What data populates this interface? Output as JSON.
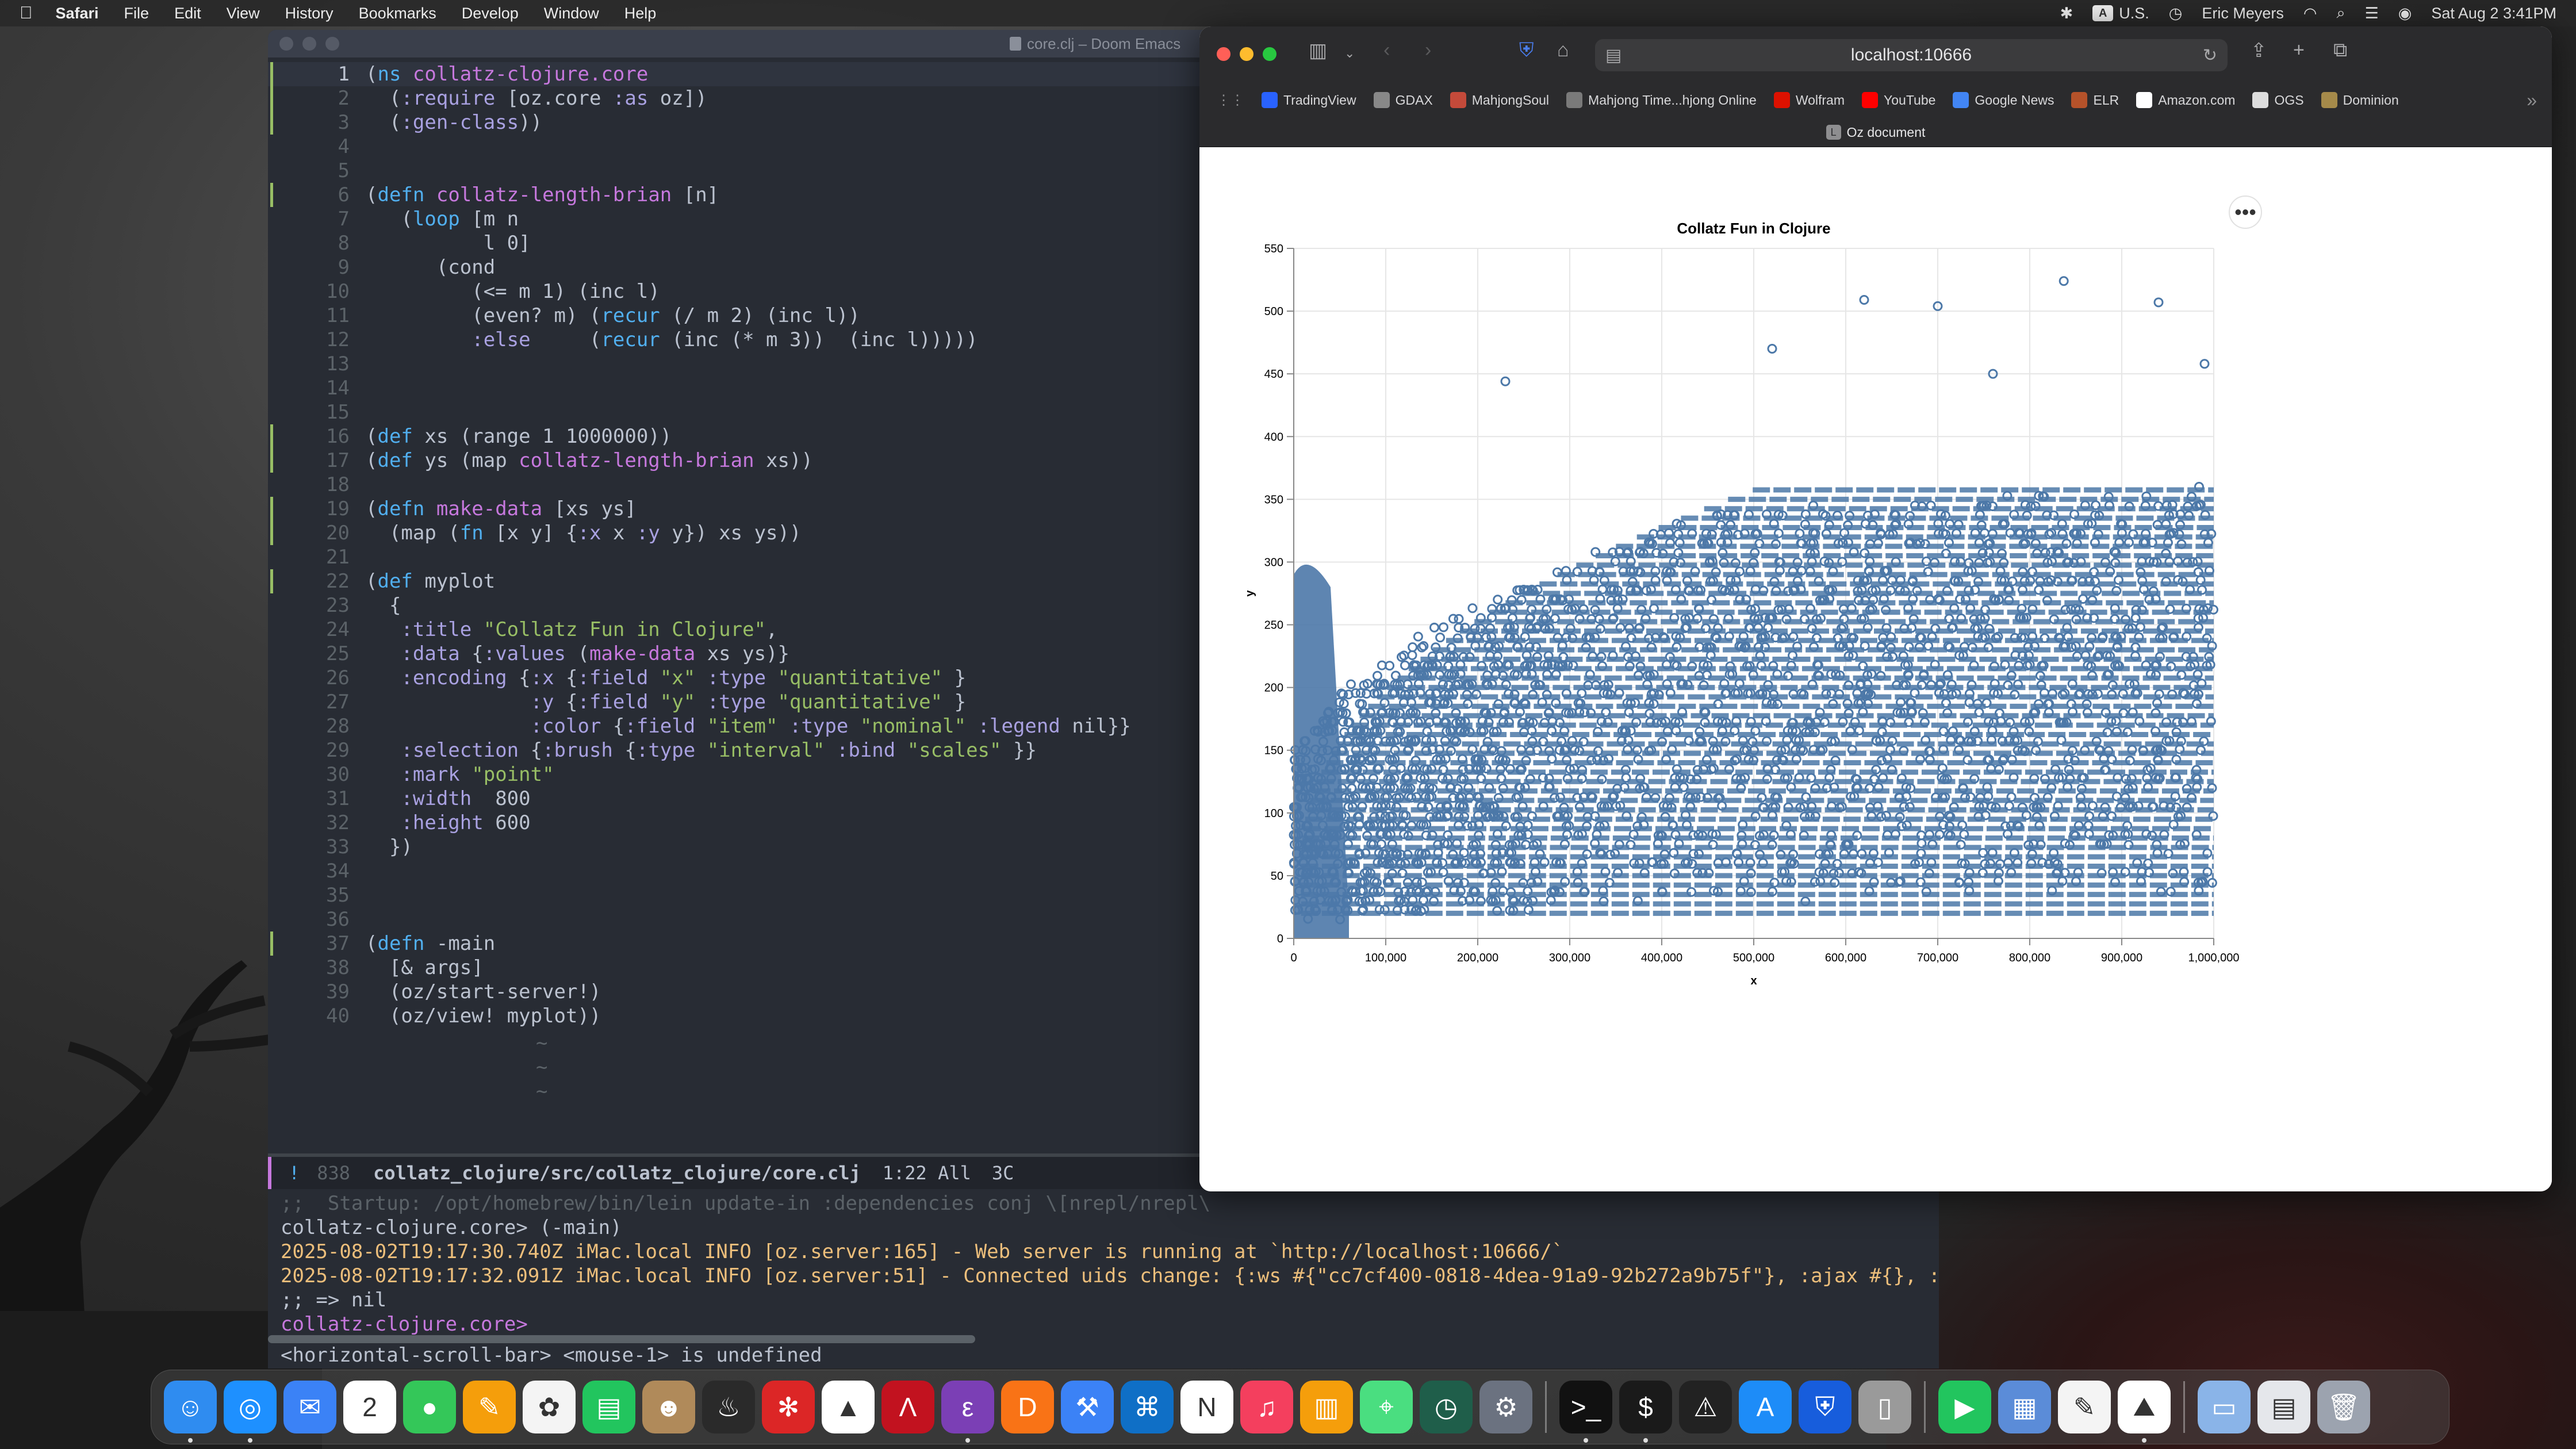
{
  "menubar": {
    "app": "Safari",
    "items": [
      "File",
      "Edit",
      "View",
      "History",
      "Bookmarks",
      "Develop",
      "Window",
      "Help"
    ],
    "input_source": "A",
    "locale": "U.S.",
    "user": "Eric Meyers",
    "datetime": "Sat Aug 2  3:41PM"
  },
  "emacs": {
    "title": "core.clj – Doom Emacs",
    "lines": [
      {
        "n": "1",
        "t": "(ns collatz-clojure.core",
        "mark": true,
        "cur": true
      },
      {
        "n": "2",
        "t": "  (:require [oz.core :as oz])",
        "mark": true
      },
      {
        "n": "3",
        "t": "  (:gen-class))",
        "mark": true
      },
      {
        "n": "4",
        "t": ""
      },
      {
        "n": "5",
        "t": ""
      },
      {
        "n": "6",
        "t": "(defn collatz-length-brian [n]",
        "mark": true
      },
      {
        "n": "7",
        "t": "   (loop [m n"
      },
      {
        "n": "8",
        "t": "          l 0]"
      },
      {
        "n": "9",
        "t": "      (cond"
      },
      {
        "n": "10",
        "t": "         (<= m 1) (inc l)"
      },
      {
        "n": "11",
        "t": "         (even? m) (recur (/ m 2) (inc l))"
      },
      {
        "n": "12",
        "t": "         :else     (recur (inc (* m 3))  (inc l)))))"
      },
      {
        "n": "13",
        "t": ""
      },
      {
        "n": "14",
        "t": ""
      },
      {
        "n": "15",
        "t": ""
      },
      {
        "n": "16",
        "t": "(def xs (range 1 1000000))",
        "mark": true
      },
      {
        "n": "17",
        "t": "(def ys (map collatz-length-brian xs))",
        "mark": true
      },
      {
        "n": "18",
        "t": ""
      },
      {
        "n": "19",
        "t": "(defn make-data [xs ys]",
        "mark": true
      },
      {
        "n": "20",
        "t": "  (map (fn [x y] {:x x :y y}) xs ys))",
        "mark": true
      },
      {
        "n": "21",
        "t": ""
      },
      {
        "n": "22",
        "t": "(def myplot",
        "mark": true
      },
      {
        "n": "23",
        "t": "  {"
      },
      {
        "n": "24",
        "t": "   :title \"Collatz Fun in Clojure\","
      },
      {
        "n": "25",
        "t": "   :data {:values (make-data xs ys)}"
      },
      {
        "n": "26",
        "t": "   :encoding {:x {:field \"x\" :type \"quantitative\" }"
      },
      {
        "n": "27",
        "t": "              :y {:field \"y\" :type \"quantitative\" }"
      },
      {
        "n": "28",
        "t": "              :color {:field \"item\" :type \"nominal\" :legend nil}}"
      },
      {
        "n": "29",
        "t": "   :selection {:brush {:type \"interval\" :bind \"scales\" }}"
      },
      {
        "n": "30",
        "t": "   :mark \"point\""
      },
      {
        "n": "31",
        "t": "   :width  800"
      },
      {
        "n": "32",
        "t": "   :height 600"
      },
      {
        "n": "33",
        "t": "  })"
      },
      {
        "n": "34",
        "t": ""
      },
      {
        "n": "35",
        "t": ""
      },
      {
        "n": "36",
        "t": ""
      },
      {
        "n": "37",
        "t": "(defn -main",
        "mark": true
      },
      {
        "n": "38",
        "t": "  [& args]"
      },
      {
        "n": "39",
        "t": "  (oz/start-server!)"
      },
      {
        "n": "40",
        "t": "  (oz/view! myplot))"
      }
    ],
    "modeline": {
      "info_icon": "!",
      "count": "838",
      "path": "collatz_clojure/src/collatz_clojure/core.clj",
      "position": "1:22 All",
      "column": "3C"
    },
    "repl": [
      {
        "t": ";;  Startup: /opt/homebrew/bin/lein update-in :dependencies conj \\[nrepl/nrepl\\",
        "c": "#5b6268"
      },
      {
        "t": "collatz-clojure.core> (-main)",
        "c": "#bbc2cf"
      },
      {
        "t": "2025-08-02T19:17:30.740Z iMac.local INFO [oz.server:165] - Web server is running at `http://localhost:10666/`",
        "c": "#ecbe7b"
      },
      {
        "t": "2025-08-02T19:17:32.091Z iMac.local INFO [oz.server:51] - Connected uids change: {:ws #{\"cc7cf400-0818-4dea-91a9-92b272a9b75f\"}, :ajax #{}, :a$",
        "c": "#ecbe7b"
      },
      {
        "t": ";; => nil",
        "c": "#bbc2cf"
      },
      {
        "t": "collatz-clojure.core>",
        "c": "#c678dd"
      }
    ],
    "minibuffer": "<horizontal-scroll-bar> <mouse-1> is undefined"
  },
  "safari": {
    "url": "localhost:10666",
    "favorites": [
      {
        "label": "TradingView",
        "color": "#2962ff"
      },
      {
        "label": "GDAX",
        "color": "#888888"
      },
      {
        "label": "MahjongSoul",
        "color": "#c44a3a"
      },
      {
        "label": "Mahjong Time...hjong Online",
        "color": "#7a7a7a"
      },
      {
        "label": "Wolfram",
        "color": "#dd1100"
      },
      {
        "label": "YouTube",
        "color": "#ff0000"
      },
      {
        "label": "Google News",
        "color": "#4285f4"
      },
      {
        "label": "ELR",
        "color": "#b5522a"
      },
      {
        "label": "Amazon.com",
        "color": "#ffffff"
      },
      {
        "label": "OGS",
        "color": "#dddddd"
      },
      {
        "label": "Dominion",
        "color": "#a58a4a"
      }
    ],
    "tab_title": "Oz document",
    "tab_icon": "L",
    "chart_menu": "•••"
  },
  "chart_data": {
    "type": "scatter",
    "title": "Collatz Fun in Clojure",
    "xlabel": "x",
    "ylabel": "y",
    "xlim": [
      0,
      1000000
    ],
    "ylim": [
      0,
      550
    ],
    "x_ticks": [
      "0",
      "100,000",
      "200,000",
      "300,000",
      "400,000",
      "500,000",
      "600,000",
      "700,000",
      "800,000",
      "900,000",
      "1,000,000"
    ],
    "y_ticks": [
      "0",
      "50",
      "100",
      "150",
      "200",
      "250",
      "300",
      "350",
      "400",
      "450",
      "500",
      "550"
    ],
    "grid": true,
    "mark": "point",
    "color": "#4c78a8",
    "outliers": [
      {
        "x": 230000,
        "y": 444
      },
      {
        "x": 520000,
        "y": 470
      },
      {
        "x": 620000,
        "y": 509
      },
      {
        "x": 700000,
        "y": 504
      },
      {
        "x": 837000,
        "y": 524
      },
      {
        "x": 940000,
        "y": 507
      },
      {
        "x": 760000,
        "y": 450
      },
      {
        "x": 990000,
        "y": 458
      }
    ]
  },
  "dock": {
    "icons": [
      {
        "name": "finder-icon",
        "color": "#2f8cf0",
        "glyph": "☺",
        "dot": true
      },
      {
        "name": "safari-icon",
        "color": "#1e90ff",
        "glyph": "◎",
        "dot": true
      },
      {
        "name": "mail-icon",
        "color": "#3b82f6",
        "glyph": "✉"
      },
      {
        "name": "calendar-icon",
        "color": "#ffffff",
        "glyph": "2"
      },
      {
        "name": "messages-icon",
        "color": "#34c759",
        "glyph": "●"
      },
      {
        "name": "pages-icon",
        "color": "#f59e0b",
        "glyph": "✎"
      },
      {
        "name": "photos-icon",
        "color": "#f4f4f4",
        "glyph": "✿"
      },
      {
        "name": "numbers-icon",
        "color": "#22c55e",
        "glyph": "▤"
      },
      {
        "name": "contacts-icon",
        "color": "#b08a5a",
        "glyph": "☻"
      },
      {
        "name": "instruments-icon",
        "color": "#2a2a2a",
        "glyph": "♨"
      },
      {
        "name": "settings-gear-red-icon",
        "color": "#dc2626",
        "glyph": "✻"
      },
      {
        "name": "matlab-icon",
        "color": "#ffffff",
        "glyph": "▲"
      },
      {
        "name": "affinity-icon",
        "color": "#c2121f",
        "glyph": "Λ"
      },
      {
        "name": "emacs-icon",
        "color": "#7b3fb5",
        "glyph": "ε",
        "dot": true
      },
      {
        "name": "dropzone-icon",
        "color": "#f97316",
        "glyph": "D"
      },
      {
        "name": "xcode-icon",
        "color": "#3b82f6",
        "glyph": "⚒"
      },
      {
        "name": "vscode-icon",
        "color": "#0f6fc6",
        "glyph": "⌘"
      },
      {
        "name": "news-icon",
        "color": "#ffffff",
        "glyph": "N"
      },
      {
        "name": "music-icon",
        "color": "#f43f5e",
        "glyph": "♫"
      },
      {
        "name": "books-icon",
        "color": "#f59e0b",
        "glyph": "▥"
      },
      {
        "name": "maps-icon",
        "color": "#4ade80",
        "glyph": "⌖"
      },
      {
        "name": "time-machine-icon",
        "color": "#1f5e4a",
        "glyph": "◷"
      },
      {
        "name": "system-settings-icon",
        "color": "#6b7280",
        "glyph": "⚙"
      },
      {
        "sep": true
      },
      {
        "name": "terminal-icon",
        "color": "#111111",
        "glyph": ">_",
        "dot": true
      },
      {
        "name": "terminal-green-icon",
        "color": "#1a1a1a",
        "glyph": "$",
        "dot": true
      },
      {
        "name": "console-icon",
        "color": "#222222",
        "glyph": "⚠"
      },
      {
        "name": "app-store-icon",
        "color": "#1d8cf8",
        "glyph": "A"
      },
      {
        "name": "bitwarden-icon",
        "color": "#175ddc",
        "glyph": "⛨"
      },
      {
        "name": "iphone-mirroring-icon",
        "color": "#9a9a9a",
        "glyph": "▯"
      },
      {
        "sep": true
      },
      {
        "name": "facetime-icon",
        "color": "#22c55e",
        "glyph": "▶"
      },
      {
        "name": "preview-icon",
        "color": "#5b8cd8",
        "glyph": "▦"
      },
      {
        "name": "textedit-icon",
        "color": "#f4f4f4",
        "glyph": "✎"
      },
      {
        "name": "grapher-icon",
        "color": "#ffffff",
        "glyph": "⛰",
        "dot": true
      },
      {
        "sep": true
      },
      {
        "name": "folder-icon",
        "color": "#8ab4e8",
        "glyph": "▭"
      },
      {
        "name": "document-icon",
        "color": "#e5e7eb",
        "glyph": "▤"
      },
      {
        "name": "trash-icon",
        "color": "#9ca3af",
        "glyph": "🗑"
      }
    ]
  }
}
